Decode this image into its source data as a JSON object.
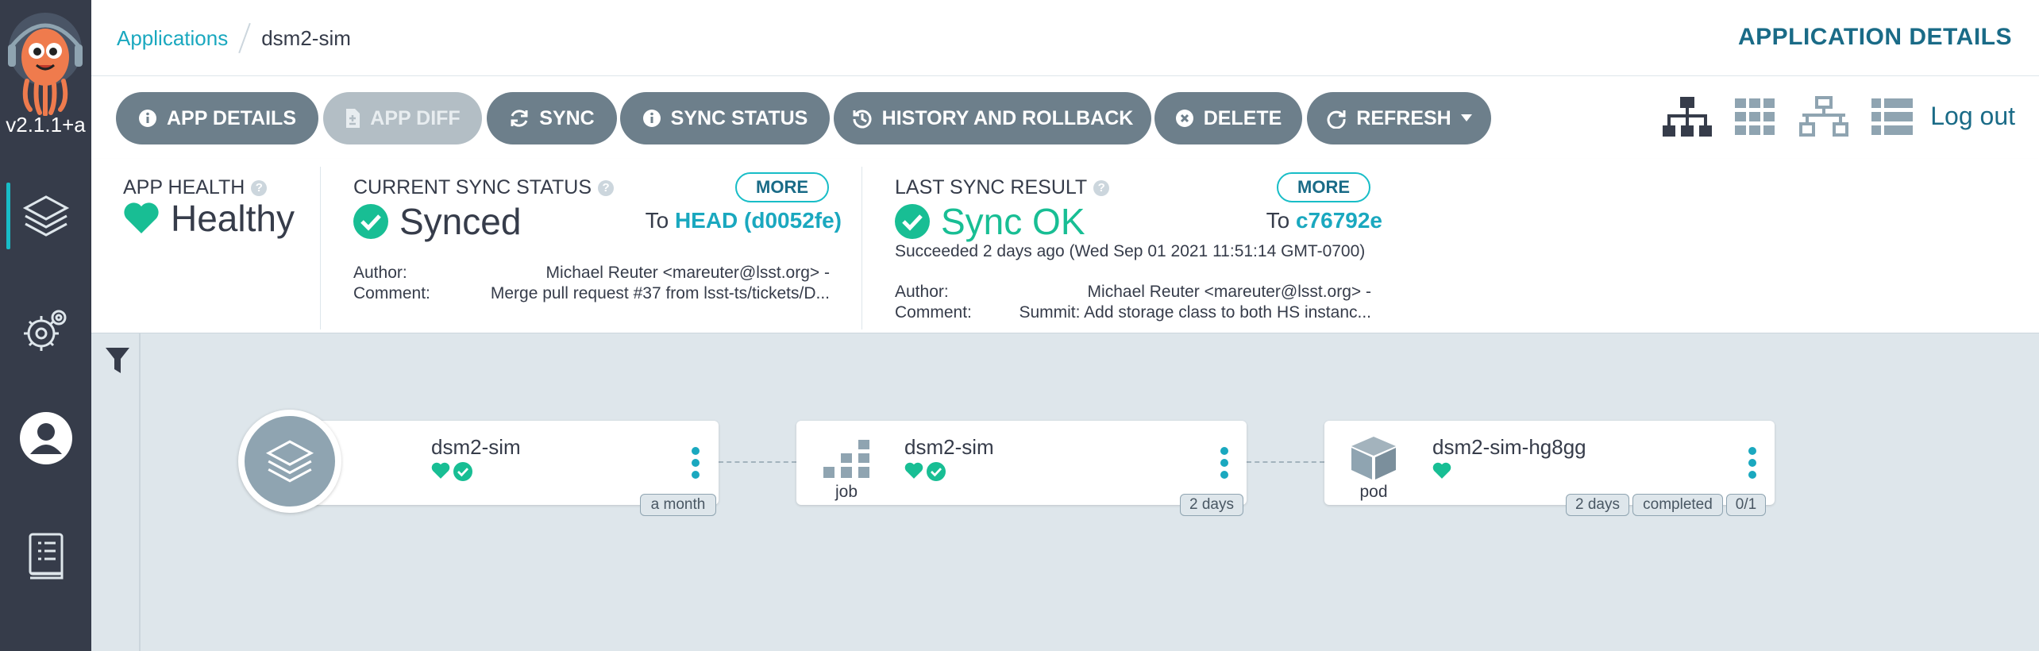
{
  "app": {
    "version": "v2.1.1+a"
  },
  "breadcrumb": {
    "parent": "Applications",
    "current": "dsm2-sim"
  },
  "header": {
    "title": "APPLICATION DETAILS"
  },
  "toolbar": {
    "app_details": "APP DETAILS",
    "app_diff": "APP DIFF",
    "sync": "SYNC",
    "sync_status": "SYNC STATUS",
    "history": "HISTORY AND ROLLBACK",
    "delete": "DELETE",
    "refresh": "REFRESH",
    "logout": "Log out"
  },
  "health": {
    "title": "APP HEALTH",
    "value": "Healthy"
  },
  "sync_status": {
    "title": "CURRENT SYNC STATUS",
    "more": "MORE",
    "value": "Synced",
    "to_prefix": "To",
    "to_ref": "HEAD (d0052fe)",
    "author_label": "Author:",
    "author": "Michael Reuter <mareuter@lsst.org> -",
    "comment_label": "Comment:",
    "comment": "Merge pull request #37 from lsst-ts/tickets/D..."
  },
  "last_sync": {
    "title": "LAST SYNC RESULT",
    "more": "MORE",
    "value": "Sync OK",
    "to_prefix": "To",
    "to_ref": "c76792e",
    "succeeded": "Succeeded 2 days ago (Wed Sep 01 2021 11:51:14 GMT-0700)",
    "author_label": "Author:",
    "author": "Michael Reuter <mareuter@lsst.org> -",
    "comment_label": "Comment:",
    "comment": "Summit: Add storage class to both HS instanc..."
  },
  "graph": {
    "nodes": [
      {
        "name": "dsm2-sim",
        "kind": "",
        "tags": [
          "a month"
        ]
      },
      {
        "name": "dsm2-sim",
        "kind": "job",
        "tags": [
          "2 days"
        ]
      },
      {
        "name": "dsm2-sim-hg8gg",
        "kind": "pod",
        "tags": [
          "2 days",
          "completed",
          "0/1"
        ]
      }
    ]
  },
  "colors": {
    "healthy": "#18be94",
    "accent": "#1aa8bf",
    "sidebar": "#363c4a",
    "button": "#6d7f8b"
  }
}
